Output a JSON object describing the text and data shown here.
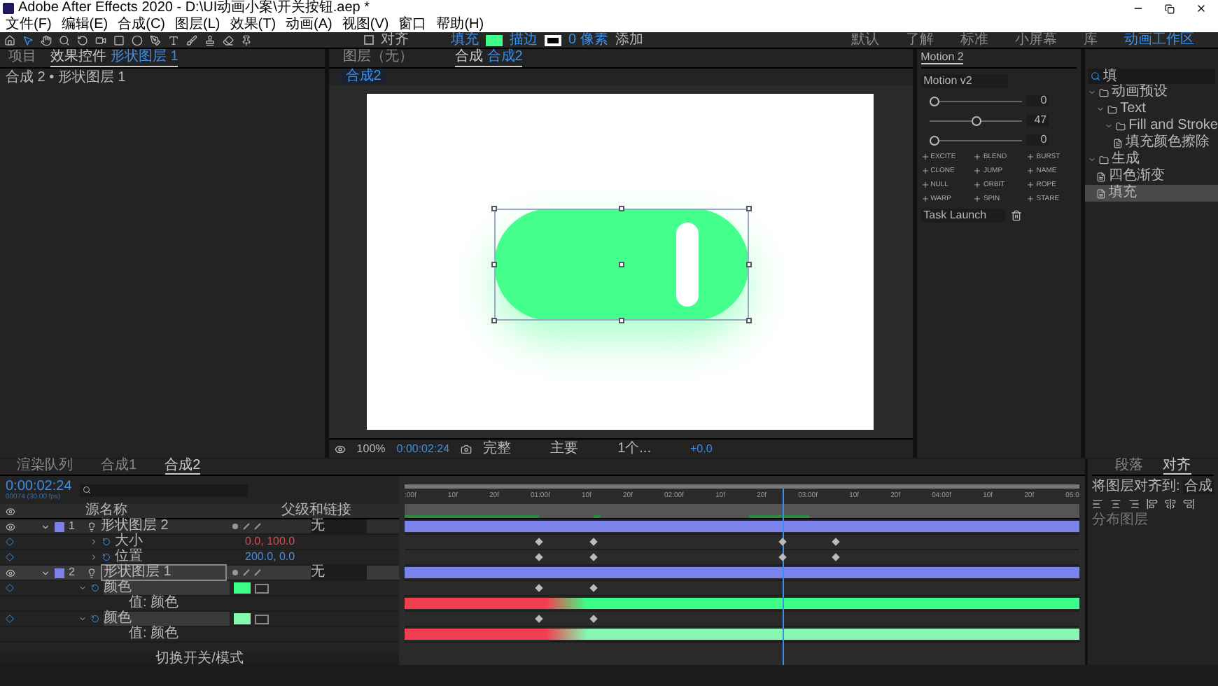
{
  "window": {
    "title": "Adobe After Effects 2020 - D:\\UI动画小案\\开关按钮.aep *"
  },
  "menu": [
    "文件(F)",
    "编辑(E)",
    "合成(C)",
    "图层(L)",
    "效果(T)",
    "动画(A)",
    "视图(V)",
    "窗口",
    "帮助(H)"
  ],
  "toolbar": {
    "snap_label": "对齐",
    "snap_checked": false,
    "fill": {
      "label": "填充",
      "color": "#3dff87"
    },
    "stroke_label": "描边",
    "stroke_width": "0 像素",
    "add_label": "添加",
    "workspaces": [
      {
        "label": "默认",
        "selected": false
      },
      {
        "label": "了解",
        "selected": false
      },
      {
        "label": "标准",
        "selected": false
      },
      {
        "label": "小屏幕",
        "selected": false
      },
      {
        "label": "库",
        "selected": false
      },
      {
        "label": "动画工作区",
        "selected": true
      }
    ]
  },
  "left_panel": {
    "tabs": [
      {
        "label": "项目",
        "selected": false
      },
      {
        "label": "效果控件",
        "layer": "形状图层 1",
        "selected": true
      }
    ],
    "breadcrumb": "合成 2 • 形状图层 1"
  },
  "composition_panel": {
    "tabs": [
      {
        "label": "图层（无）",
        "selected": false
      },
      {
        "label": "合成",
        "layer": "合成2",
        "selected": true
      }
    ],
    "subtab": "合成2",
    "bottom_bar": {
      "zoom": "100%",
      "time": "0:00:02:24",
      "resolution": "完整",
      "view": "主要",
      "views": "1个...",
      "exposure": "+0.0"
    }
  },
  "motion_panel": {
    "title": "Motion 2",
    "preset": "Motion v2",
    "sliders": [
      {
        "value": "0",
        "level": 0.05
      },
      {
        "value": "47",
        "level": 0.5
      },
      {
        "value": "0",
        "level": 0.05
      }
    ],
    "buttons": [
      "EXCITE",
      "BLEND",
      "BURST",
      "CLONE",
      "JUMP",
      "NAME",
      "NULL",
      "ORBIT",
      "ROPE",
      "WARP",
      "SPIN",
      "STARE"
    ],
    "launch": "Task Launch"
  },
  "presets_panel": {
    "search": "填",
    "tree": [
      {
        "label": "动画预设",
        "expanded": true,
        "selected": false,
        "children": [
          {
            "label": "Text",
            "expanded": true,
            "selected": false,
            "children": [
              {
                "label": "Fill and Stroke",
                "expanded": true,
                "selected": false,
                "children": [
                  {
                    "label": "填充颜色擦除",
                    "selected": false
                  }
                ]
              }
            ]
          }
        ]
      },
      {
        "label": "生成",
        "expanded": true,
        "selected": false,
        "children": [
          {
            "label": "四色渐变",
            "selected": false
          },
          {
            "label": "填充",
            "selected": true
          }
        ]
      }
    ]
  },
  "timeline": {
    "tabs": [
      {
        "label": "渲染队列",
        "selected": false
      },
      {
        "label": "合成1",
        "selected": false
      },
      {
        "label": "合成2",
        "selected": true
      }
    ],
    "time": "0:00:02:24",
    "frame_info": "00074 (30.00 fps)",
    "columns": {
      "name": "源名称",
      "parent": "父级和链接"
    },
    "rows": [
      {
        "kind": "layer",
        "index": "1",
        "name": "形状图层 2",
        "color": "#7b83eb",
        "selected": false,
        "expanded": true,
        "parent": "无"
      },
      {
        "kind": "property",
        "name": "大小",
        "value": "0.0, 100.0",
        "color": "#e0464e",
        "expanded": false
      },
      {
        "kind": "property",
        "name": "位置",
        "value": "200.0, 0.0",
        "color": "#4a8de0",
        "expanded": false
      },
      {
        "kind": "layer",
        "index": "2",
        "name": "形状图层 1",
        "color": "#7b83eb",
        "selected": true,
        "expanded": true,
        "parent": "无"
      },
      {
        "kind": "color_property",
        "name": "颜色",
        "color": "#3dff87",
        "expanded": true
      },
      {
        "kind": "value",
        "label": "值: 颜色"
      },
      {
        "kind": "color_property",
        "name": "颜色",
        "color": "#86f7b0",
        "expanded": true
      },
      {
        "kind": "value",
        "label": "值: 颜色"
      }
    ],
    "ruler": [
      ":00f",
      "10f",
      "20f",
      "01:00f",
      "10f",
      "20f",
      "02:00f",
      "10f",
      "20f",
      "03:00f",
      "10f",
      "20f",
      "04:00f",
      "10f",
      "20f",
      "05:0"
    ],
    "playhead": {
      "level": 0.56
    },
    "footer": "切换开关/模式"
  },
  "align_panel": {
    "tabs": [
      {
        "label": "段落",
        "selected": false
      },
      {
        "label": "对齐",
        "selected": true
      }
    ],
    "align_to_label": "将图层对齐到:",
    "align_to": "合成",
    "distribute": "分布图层"
  }
}
